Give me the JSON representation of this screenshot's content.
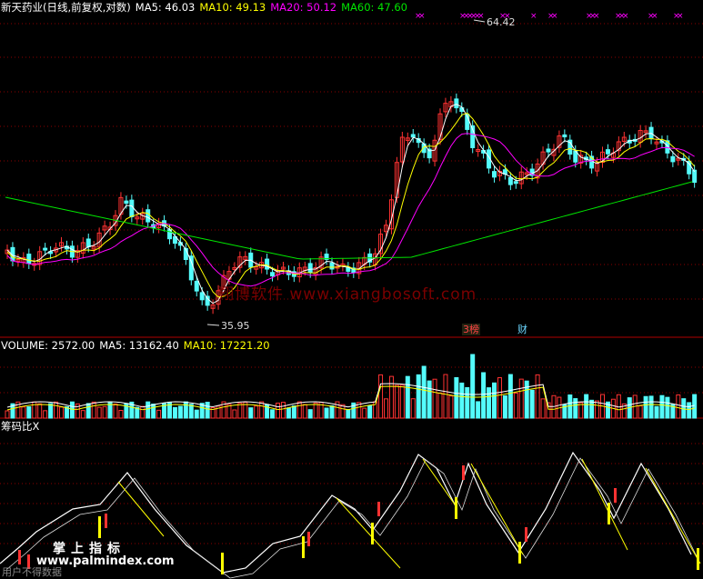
{
  "price_header": {
    "title": "新天药业(日线,前复权,对数)",
    "ma5": "MA5: 46.03",
    "ma10": "MA10: 49.13",
    "ma20": "MA20: 50.12",
    "ma60": "MA60: 47.60"
  },
  "volume_header": {
    "label": "VOLUME: 2572.00",
    "ma5": "MA5: 13162.40",
    "ma10": "MA10: 17221.20"
  },
  "indicator_header": {
    "label": "筹码比X"
  },
  "price_labels": {
    "high": "64.42",
    "low": "35.95"
  },
  "watermark": "翔博软件 www.xiangbosoft.com",
  "event_tags": {
    "tag1": "3榜",
    "tag2": "财"
  },
  "overlay_text": {
    "center": "掌上指标",
    "site": "www.palmindex.com",
    "bottom_left": "用户不得数据"
  },
  "colors": {
    "up": "#ff3232",
    "down": "#54fcfc",
    "ma5": "#ffffff",
    "ma10": "#ffff00",
    "ma20": "#ff00ff",
    "ma60": "#00e600",
    "grid": "#8b0000",
    "cross": "#ff00ff"
  },
  "chart_data": [
    {
      "type": "candlestick",
      "title": "新天药业(日线,前复权,对数)",
      "series": [
        {
          "name": "MA5",
          "last": 46.03
        },
        {
          "name": "MA10",
          "last": 49.13
        },
        {
          "name": "MA20",
          "last": 50.12
        },
        {
          "name": "MA60",
          "last": 47.6
        }
      ],
      "high": 64.42,
      "low": 35.95
    },
    {
      "type": "bar",
      "title": "VOLUME",
      "series": [
        {
          "name": "VOLUME",
          "last": 2572.0
        },
        {
          "name": "MA5",
          "last": 13162.4
        },
        {
          "name": "MA10",
          "last": 17221.2
        }
      ]
    },
    {
      "type": "line",
      "title": "筹码比X"
    }
  ]
}
